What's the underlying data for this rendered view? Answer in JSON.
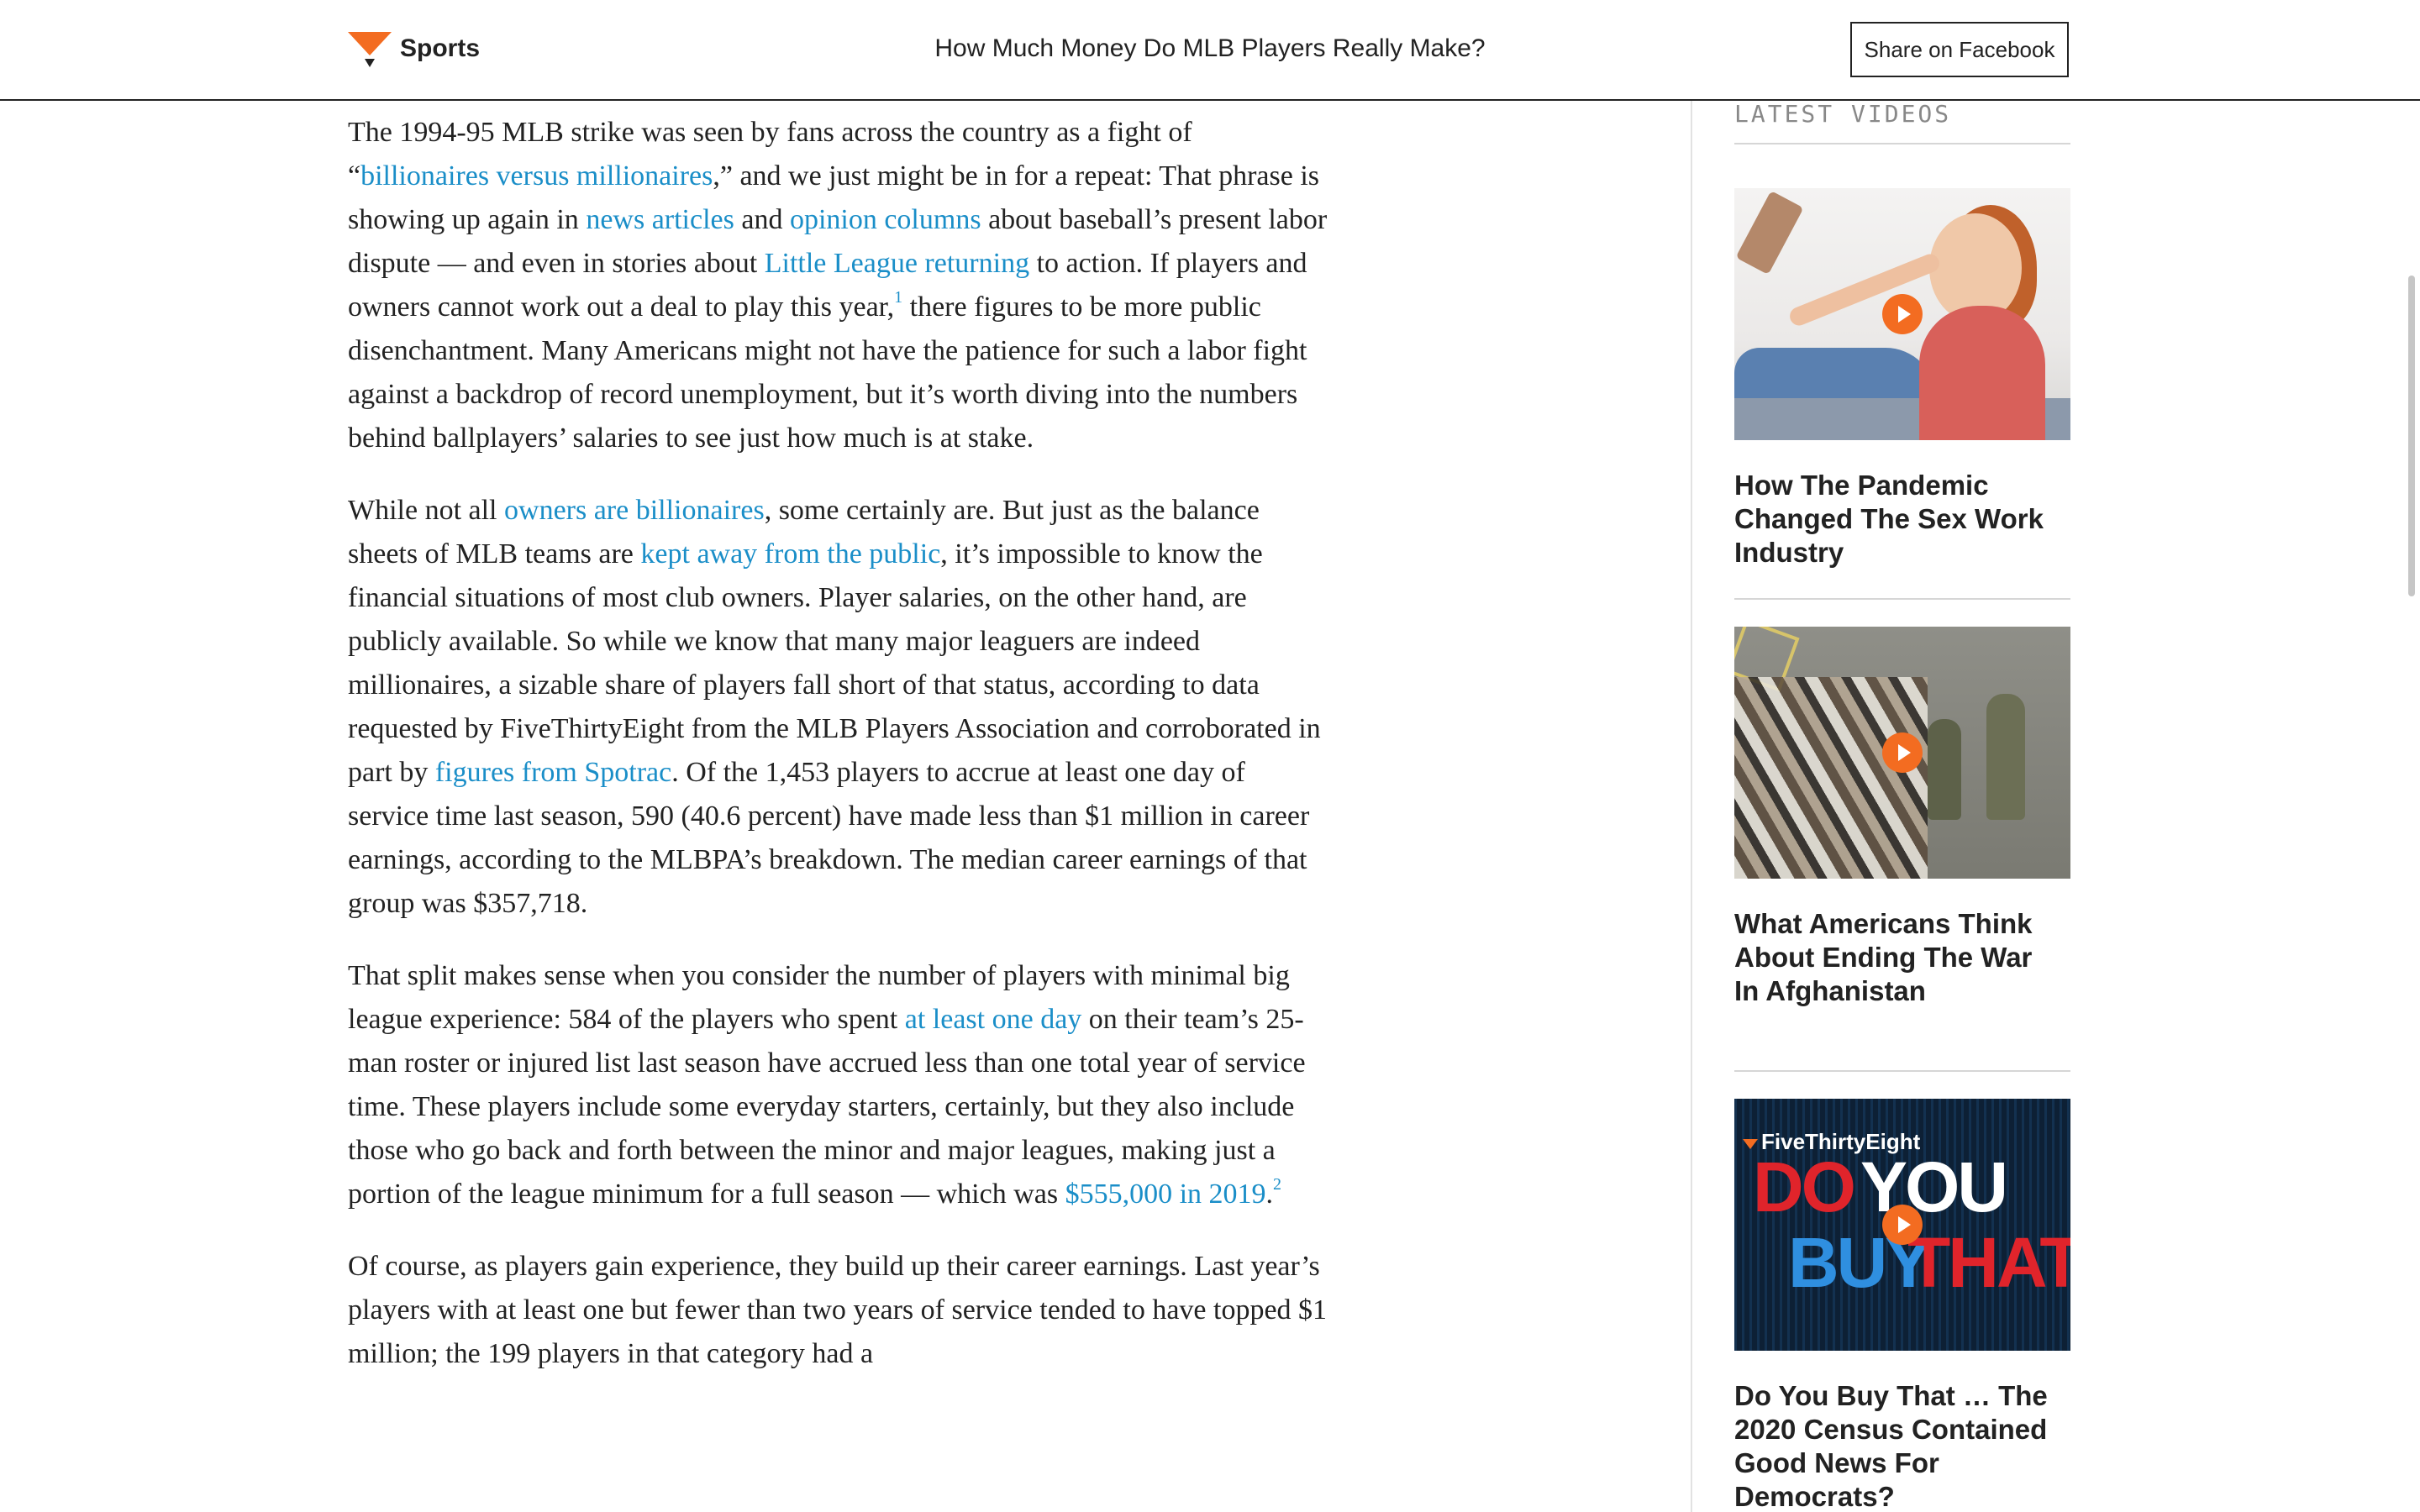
{
  "header": {
    "section": "Sports",
    "title": "How Much Money Do MLB Players Really Make?",
    "share_label": "Share on Facebook",
    "logo_color": "#f36c21"
  },
  "article": {
    "link_color": "#1a8ec8",
    "p1": {
      "t1": "The 1994-95 MLB strike was seen by fans across the country as a fight of “",
      "l1": "billionaires versus millionaires",
      "t2": ",” and we just might be in for a repeat: That phrase is showing up again in ",
      "l2": "news articles",
      "t3": " and ",
      "l3": "opinion columns",
      "t4": " about baseball’s present labor dispute — and even in stories about ",
      "l4": "Little League returning",
      "t5": " to action. If players and owners cannot work out a deal to play this year,",
      "fn": "1",
      "t6": " there figures to be more public disenchantment. Many Americans might not have the patience for such a labor fight against a backdrop of record unemployment, but it’s worth diving into the numbers behind ballplayers’ salaries to see just how much is at stake."
    },
    "p2": {
      "t1": "While not all ",
      "l1": "owners are billionaires",
      "t2": ", some certainly are. But just as the balance sheets of MLB teams are ",
      "l2": "kept away from the public",
      "t3": ", it’s impossible to know the financial situations of most club owners. Player salaries, on the other hand, are publicly available. So while we know that many major leaguers are indeed millionaires, a sizable share of players fall short of that status, according to data requested by FiveThirtyEight from the MLB Players Association and corroborated in part by ",
      "l3": "figures from Spotrac",
      "t4": ". Of the 1,453 players to accrue at least one day of service time last season, 590 (40.6 percent) have made less than $1 million in career earnings, according to the MLBPA’s breakdown. The median career earnings of that group was $357,718."
    },
    "p3": {
      "t1": "That split makes sense when you consider the number of players with minimal big league experience: 584 of the players who spent ",
      "l1": "at least one day",
      "t2": " on their team’s 25-man roster or injured list last season have accrued less than one total year of service time. These players include some everyday starters, certainly, but they also include those who go back and forth between the minor and major leagues, making just a portion of the league minimum for a full season — which was ",
      "l2": "$555,000 in 2019",
      "t3": ".",
      "fn": "2"
    },
    "p4": {
      "t1": "Of course, as players gain experience, they build up their career earnings. Last year’s players with at least one but fewer than two years of service tended to have topped $1 million; the 199 players in that category had a"
    }
  },
  "sidebar": {
    "heading": "LATEST VIDEOS",
    "videos": [
      {
        "title": "How The Pandemic Changed The Sex Work Industry",
        "thumb_icon": "selfie-photo"
      },
      {
        "title": "What Americans Think About Ending The War In Afghanistan",
        "thumb_icon": "airport-crowd-photo"
      },
      {
        "title": "Do You Buy That … The 2020 Census Contained Good News For Democrats?",
        "thumb_icon": "do-you-buy-that-graphic",
        "thumb_text": {
          "brand": "FiveThirtyEight",
          "w1": "DO",
          "w2": "YOU",
          "w3": "BUY",
          "w4": "THAT?"
        }
      }
    ]
  }
}
